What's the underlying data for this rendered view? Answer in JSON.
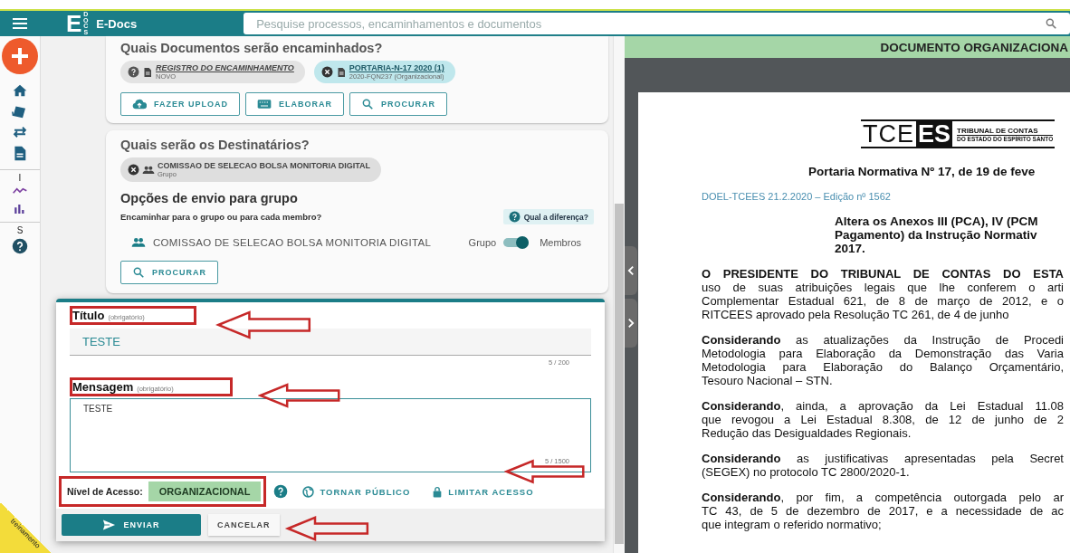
{
  "top_bar": {
    "logo_letter": "E",
    "logo_tag": "DOCS",
    "app_name": "E-Docs",
    "search": {
      "placeholder": "Pesquise processos, encaminhamentos e documentos"
    }
  },
  "sidebar": {
    "section_labels": [
      "I",
      "S"
    ]
  },
  "documents_card": {
    "title": "Quais Documentos serão encaminhados?",
    "documents": [
      {
        "name": "REGISTRO DO ENCAMINHAMENTO",
        "detail": "NOVO",
        "kind": "new"
      },
      {
        "name": "PORTARIA-N-17 2020 (1)",
        "detail": "2020-FQN237 (Organizacional)",
        "kind": "attached"
      }
    ],
    "buttons": [
      {
        "label": "FAZER UPLOAD",
        "kind": "upload"
      },
      {
        "label": "ELABORAR",
        "kind": "compose"
      },
      {
        "label": "PROCURAR",
        "kind": "search"
      }
    ]
  },
  "recipients_card": {
    "title": "Quais serão os Destinatários?",
    "recipients": [
      {
        "name": "COMISSAO DE SELECAO BOLSA MONITORIA DIGITAL",
        "detail": "Grupo"
      }
    ],
    "group_options": {
      "title": "Opções de envio para grupo",
      "question": "Encaminhar para o grupo ou para cada membro?",
      "help_link": "Qual a diferença?",
      "groups": [
        {
          "name": "COMISSAO DE SELECAO BOLSA MONITORIA DIGITAL",
          "left_label": "Grupo",
          "right_label": "Membros",
          "on": true
        }
      ]
    },
    "search_button": "PROCURAR"
  },
  "send_form": {
    "title_field": {
      "label": "Título",
      "hint": "(obrigatório)",
      "value": "TESTE",
      "counter": "5 / 200"
    },
    "message_field": {
      "label": "Mensagem",
      "hint": "(obrigatório)",
      "value": "TESTE",
      "counter": "5 / 1500"
    },
    "access": {
      "label": "Nível de Acesso:",
      "level": "ORGANIZACIONAL",
      "actions": [
        {
          "label": "TORNAR PÚBLICO",
          "kind": "public"
        },
        {
          "label": "LIMITAR ACESSO",
          "kind": "restrict"
        }
      ]
    },
    "buttons": [
      {
        "label": "ENVIAR",
        "kind": "primary"
      },
      {
        "label": "CANCELAR",
        "kind": "secondary"
      }
    ]
  },
  "environment_badge": {
    "label": "treinamento"
  },
  "document_viewer": {
    "header": "DOCUMENTO ORGANIZACIONA",
    "logo": {
      "mark_left": "TCE",
      "mark_right": "ES",
      "name": "TRIBUNAL DE CONTAS",
      "subtitle": "DO ESTADO DO ESPÍRITO SANTO"
    },
    "title": "Portaria Normativa Nº 17, de 19 de feve",
    "edition": "DOEL-TCEES 21.2.2020 – Edição nº 1562",
    "summary": [
      "Altera os Anexos III (PCA), IV (PCM",
      "Pagamento) da Instrução Normativ",
      "2017."
    ],
    "paragraphs": [
      [
        "**O PRESIDENTE DO TRIBUNAL DE CONTAS DO ESTA**",
        "uso de suas atribuições legais que lhe conferem o arti",
        "Complementar Estadual 621, de 8 de março de 2012, e o",
        "RITCEES aprovado pela Resolução TC 261, de 4 de junho"
      ],
      [
        "**Considerando** as atualizações da Instrução de Procedi",
        "Metodologia para Elaboração da Demonstração das Varia",
        "Metodologia para Elaboração do Balanço Orçamentário,",
        "Tesouro Nacional – STN."
      ],
      [
        "**Considerando**, ainda, a aprovação da Lei Estadual 11.08",
        "que revogou a Lei Estadual 8.308, de 12 de junho de 2",
        "Redução das Desigualdades Regionais."
      ],
      [
        "**Considerando** as justificativas apresentadas pela Secret",
        "(SEGEX) no protocolo TC 2800/2020-1."
      ],
      [
        "**Considerando**, por fim, a competência outorgada pelo ar",
        "TC 43, de 5 de dezembro de 2017, e a necessidade de ac",
        "que integram o referido normativo;"
      ]
    ]
  }
}
